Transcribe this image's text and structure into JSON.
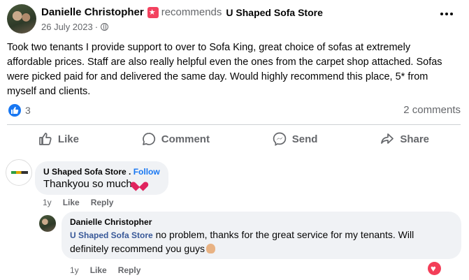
{
  "post": {
    "author": "Danielle Christopher",
    "recommends_word": "recommends",
    "page_name": "U Shaped Sofa Store",
    "date": "26 July 2023",
    "date_separator": "·",
    "body": "Took two tenants I provide support to over to Sofa King, great choice of sofas at extremely affordable prices. Staff are also really helpful even the ones from the carpet shop attached. Sofas were picked paid for and delivered the same day. Would highly recommend this place, 5* from myself and clients.",
    "reaction_count": "3",
    "comment_count": "2 comments"
  },
  "actions": {
    "like": "Like",
    "comment": "Comment",
    "send": "Send",
    "share": "Share"
  },
  "comments": [
    {
      "author": "U Shaped Sofa Store",
      "follow_sep": ".",
      "follow": "Follow",
      "text": "Thankyou so much",
      "time": "1y",
      "like": "Like",
      "reply": "Reply"
    },
    {
      "author": "Danielle Christopher",
      "tag": "U Shaped Sofa Store",
      "text": " no problem, thanks for the great service for my tenants. Will definitely recommend you guys",
      "time": "1y",
      "like": "Like",
      "reply": "Reply"
    }
  ],
  "colors": {
    "accent": "#1877f2",
    "secondary_text": "#65676b",
    "bubble": "#f0f2f5",
    "badge": "#f3425f",
    "love": "#f33e58"
  }
}
